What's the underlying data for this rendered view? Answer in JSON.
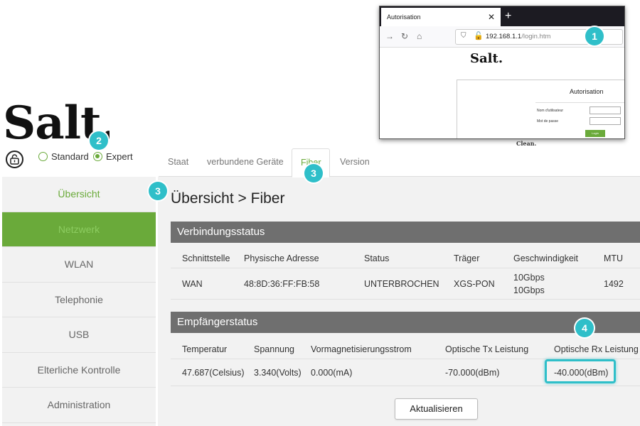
{
  "logo": {
    "text": "Salt."
  },
  "mode": {
    "standard": "Standard",
    "expert": "Expert",
    "selected": "Expert"
  },
  "tabs": [
    {
      "label": "Staat"
    },
    {
      "label": "verbundene Geräte"
    },
    {
      "label": "Fiber",
      "active": true
    },
    {
      "label": "Version"
    }
  ],
  "sidebar": {
    "items": [
      {
        "label": "Übersicht"
      },
      {
        "label": "Netzwerk"
      },
      {
        "label": "WLAN"
      },
      {
        "label": "Telephonie"
      },
      {
        "label": "USB"
      },
      {
        "label": "Elterliche Kontrolle"
      },
      {
        "label": "Administration"
      }
    ]
  },
  "page_title": "Übersicht > Fiber",
  "connection": {
    "heading": "Verbindungsstatus",
    "columns": [
      "Schnittstelle",
      "Physische Adresse",
      "Status",
      "Träger",
      "Geschwindigkeit",
      "MTU"
    ],
    "row": {
      "interface": "WAN",
      "mac": "48:8D:36:FF:FB:58",
      "status": "UNTERBROCHEN",
      "carrier": "XGS-PON",
      "speed_down": "10Gbps",
      "speed_up": "10Gbps",
      "mtu": "1492"
    }
  },
  "receiver": {
    "heading": "Empfängerstatus",
    "columns": [
      "Temperatur",
      "Spannung",
      "Vormagnetisierungsstrom",
      "Optische Tx Leistung",
      "Optische Rx Leistung"
    ],
    "row": {
      "temperature": "47.687(Celsius)",
      "voltage": "3.340(Volts)",
      "bias": "0.000(mA)",
      "tx": "-70.000(dBm)",
      "rx": "-40.000(dBm)"
    }
  },
  "refresh_button": "Aktualisieren",
  "annotations": [
    "1",
    "2",
    "3",
    "3",
    "4"
  ],
  "browser_inset": {
    "tab_title": "Autorisation",
    "url_host": "192.168.1.1",
    "url_path": "/login.htm",
    "logo": "Salt.",
    "login_title": "Autorisation",
    "username_label": "Nom d'utilisateur",
    "password_label": "Mot de passe",
    "login_button": "Login",
    "footer_text": "Clean."
  },
  "colors": {
    "accent": "#6aaa3a",
    "annotation": "#2fbfc9",
    "panel_header": "#6f6f6f"
  }
}
